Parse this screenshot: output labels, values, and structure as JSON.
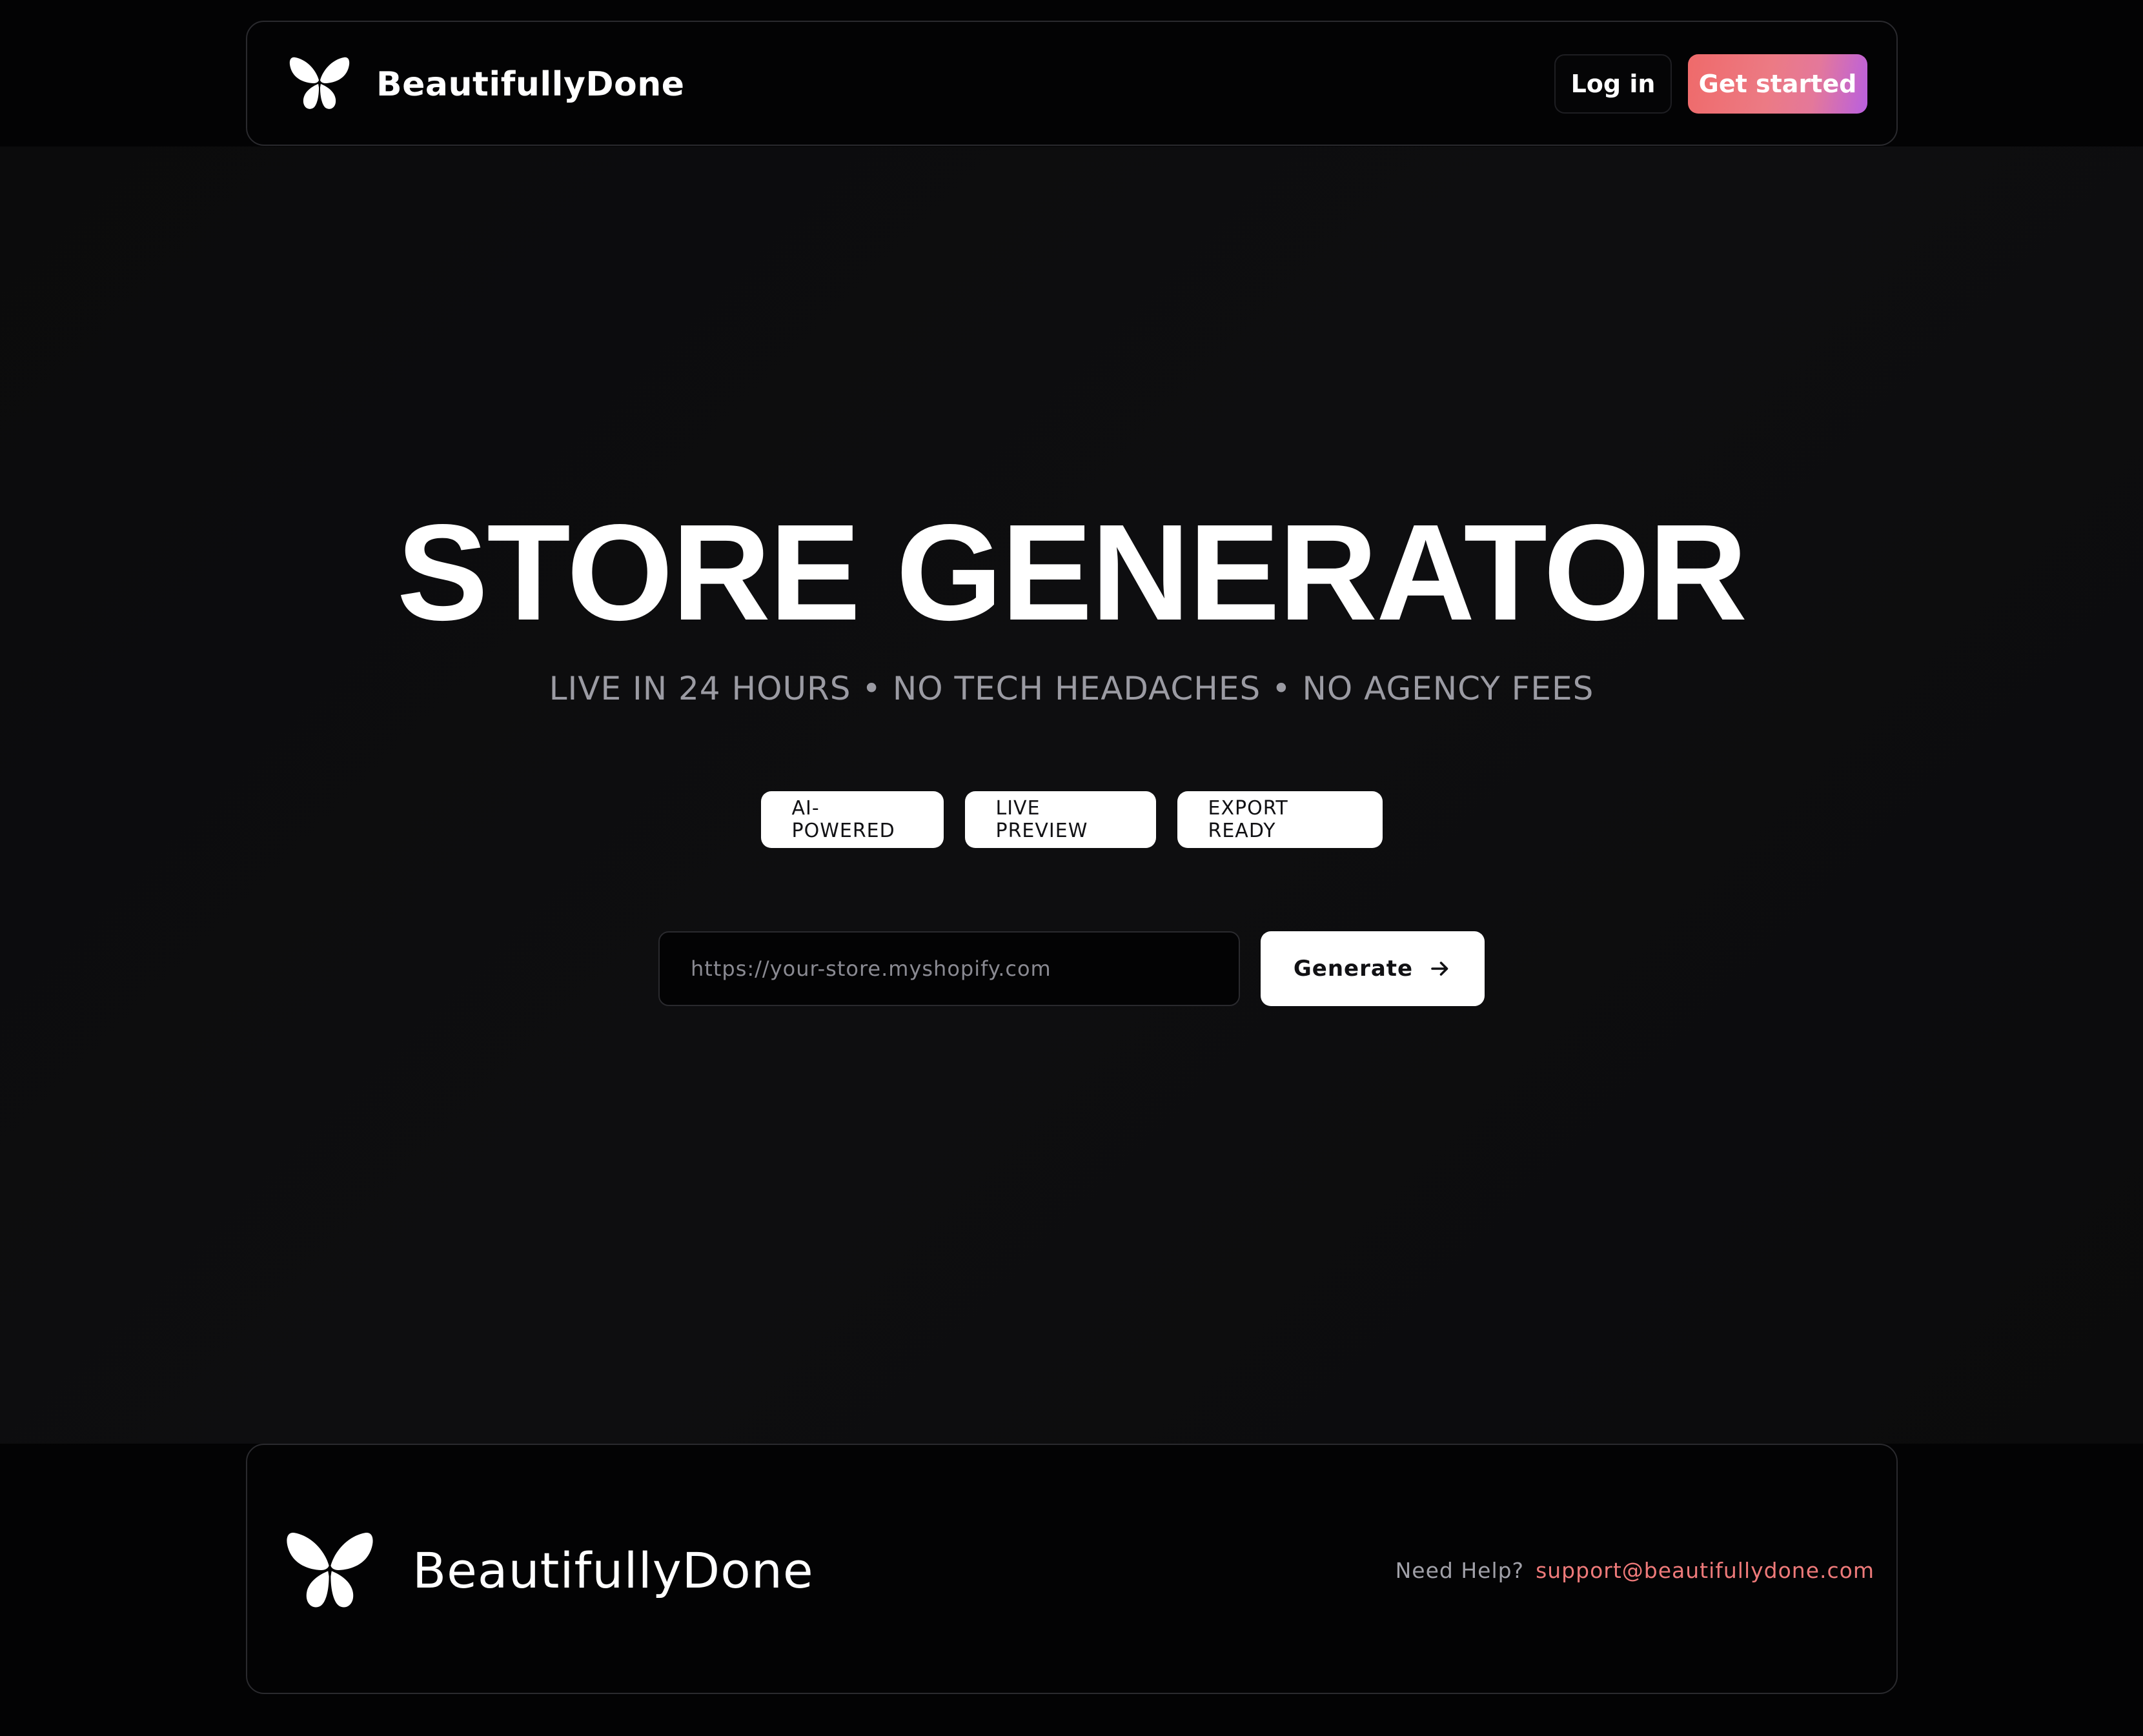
{
  "header": {
    "brand": "BeautifullyDone",
    "login_label": "Log in",
    "cta_label": "Get started",
    "logo_icon": "butterfly-icon"
  },
  "hero": {
    "title": "STORE GENERATOR",
    "subtitle": "LIVE IN 24 HOURS • NO TECH HEADACHES • NO AGENCY FEES",
    "pills": [
      "AI-POWERED",
      "LIVE PREVIEW",
      "EXPORT READY"
    ],
    "url_placeholder": "https://your-store.myshopify.com",
    "url_value": "",
    "generate_label": "Generate",
    "generate_icon": "arrow-right-icon"
  },
  "footer": {
    "brand": "BeautifullyDone",
    "help_label": "Need Help?",
    "support_email": "support@beautifullydone.com",
    "logo_icon": "butterfly-icon"
  },
  "colors": {
    "background": "#030304",
    "hero_background": "#0c0c0e",
    "accent_gradient_start": "#ef6a6a",
    "accent_gradient_end": "#b95fe0",
    "link": "#ee7a7a",
    "subtitle": "#9b9ba3"
  }
}
